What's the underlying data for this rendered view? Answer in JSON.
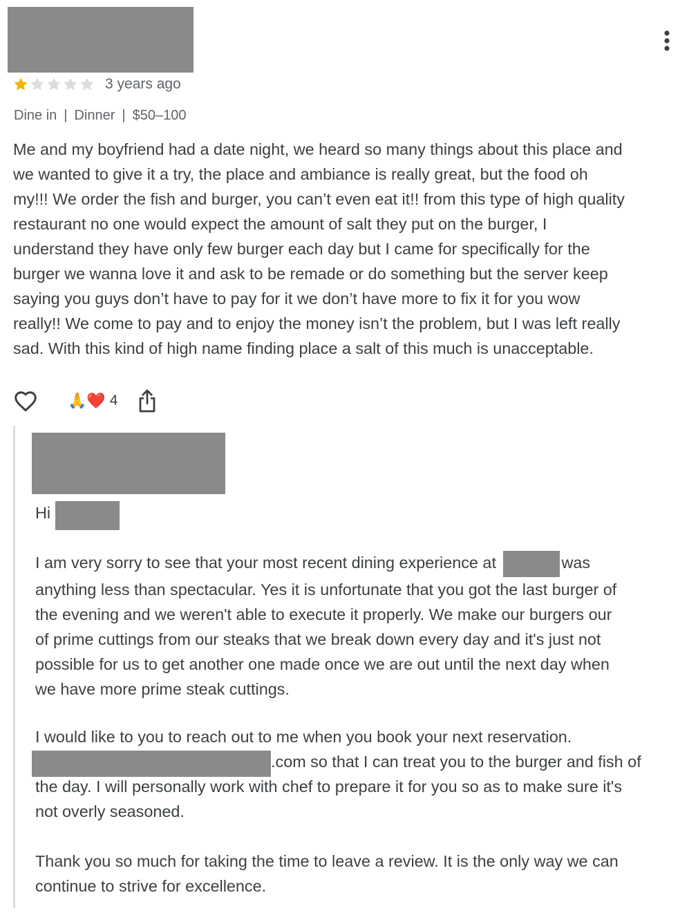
{
  "review": {
    "more_icon": "more-vert-icon",
    "rating": 1,
    "max_rating": 5,
    "star_color": "#f4b400",
    "star_empty_color": "#dadce0",
    "time_ago": "3 years ago",
    "meta": [
      "Dine in",
      "Dinner",
      "$50–100"
    ],
    "meta_separator": "|",
    "text_lines": [
      "Me and my boyfriend had a date night, we heard so many things about this place and",
      "we wanted to give it a try, the place and ambiance is really great, but the food oh",
      "my!!! We order the fish and burger, you can’t even eat it!! from this type of high quality",
      "restaurant no one would expect the amount of salt they put on the burger, I",
      "understand they have only few burger each day but I came for specifically for the",
      "burger we wanna love it and ask to be remade or do something but the server keep",
      "saying you guys don’t have to pay for it we don’t have more to fix it for you wow",
      "really!! We come to pay and to enjoy the money isn’t the problem, but I was left really",
      "sad. With this kind of high name finding place a salt of this much is unacceptable."
    ]
  },
  "actions": {
    "like_icon": "heart-outline-icon",
    "reaction_emoji": "🙏❤️",
    "reaction_count": "4",
    "share_icon": "share-icon"
  },
  "reply": {
    "greeting": "Hi",
    "p1_line1_before": "I am very sorry to see that your most recent dining experience at",
    "p1_line1_after": "was",
    "p1_lines": [
      "anything less than spectacular. Yes it is unfortunate that you got the last burger of",
      "the evening and we weren't able to execute it properly. We make our burgers our",
      "of prime cuttings from our steaks that we break down every day and it's just not",
      "possible for us to get another one made once we are out until the next day when",
      "we have more prime steak cuttings."
    ],
    "p2_line1": "I would like to you to reach out to me when you book your next reservation.",
    "p2_line2_after": ".com so that I can treat you to the burger and fish of",
    "p2_lines": [
      "the day. I will personally work with chef to prepare it for you so as to make sure it's",
      "not overly seasoned."
    ],
    "p3_lines": [
      "Thank you so much for taking the time to leave a review. It is the only way we can",
      "continue to strive for excellence."
    ]
  }
}
